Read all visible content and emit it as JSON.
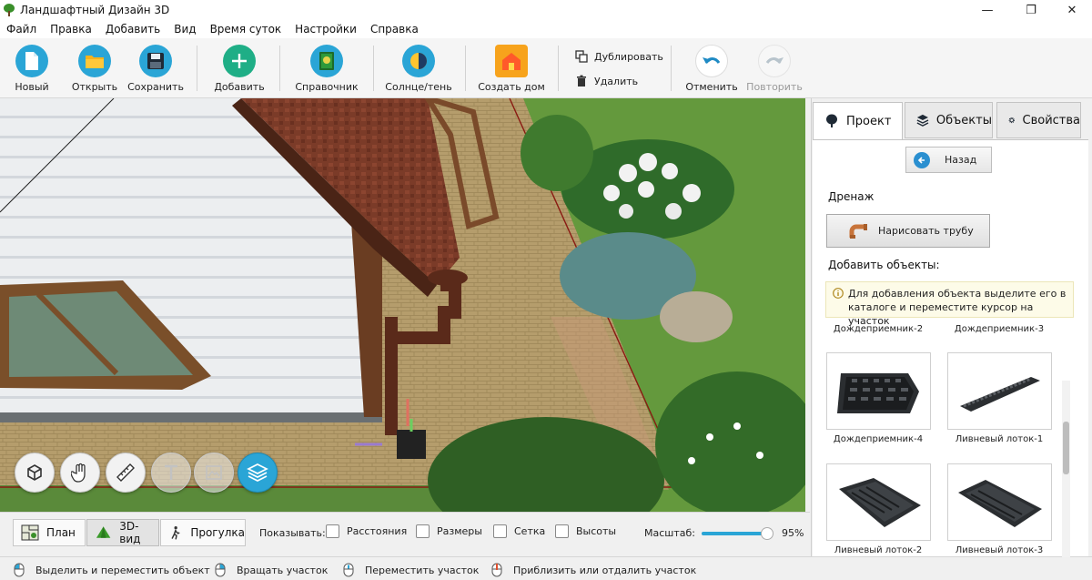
{
  "window": {
    "title": "Ландшафтный Дизайн 3D",
    "controls": {
      "minimize": "—",
      "maximize": "❐",
      "close": "✕"
    }
  },
  "menu": [
    "Файл",
    "Правка",
    "Добавить",
    "Вид",
    "Время суток",
    "Настройки",
    "Справка"
  ],
  "toolbar": {
    "new": "Новый",
    "open": "Открыть",
    "save": "Сохранить",
    "add": "Добавить",
    "reference": "Справочник",
    "sun_shadow": "Солнце/тень",
    "create_house": "Создать дом",
    "duplicate": "Дублировать",
    "delete": "Удалить",
    "undo": "Отменить",
    "redo": "Повторить"
  },
  "viewport_tools": [
    "rotate-view-icon",
    "pan-hand-icon",
    "ruler-icon",
    "text-icon",
    "image-icon",
    "layers-icon"
  ],
  "view_modes": {
    "plan": "План",
    "view3d": "3D-вид",
    "walk": "Прогулка",
    "active": "3D-вид"
  },
  "show": {
    "label": "Показывать:",
    "options": [
      {
        "label": "Расстояния",
        "checked": false
      },
      {
        "label": "Размеры",
        "checked": false
      },
      {
        "label": "Сетка",
        "checked": false
      },
      {
        "label": "Высоты",
        "checked": false
      }
    ]
  },
  "zoom": {
    "label": "Масштаб:",
    "value": "95%",
    "fraction": 0.92
  },
  "status_hints": [
    "Выделить и переместить объект",
    "Вращать участок",
    "Переместить участок",
    "Приблизить или отдалить участок"
  ],
  "panel": {
    "tabs": [
      "Проект",
      "Объекты",
      "Свойства"
    ],
    "active_tab": "Проект",
    "back_button": "Назад",
    "section_title": "Дренаж",
    "draw_pipe_button": "Нарисовать трубу",
    "add_objects_title": "Добавить объекты:",
    "notice": "Для добавления объекта выделите его в каталоге и переместите курсор на участок",
    "catalog_top_labels": [
      "Дождеприемник-2",
      "Дождеприемник-3"
    ],
    "catalog": [
      {
        "label": "Дождеприемник-4"
      },
      {
        "label": "Ливневый лоток-1"
      },
      {
        "label": "Ливневый лоток-2"
      },
      {
        "label": "Ливневый лоток-3"
      }
    ]
  },
  "colors": {
    "accent": "#2aa5d6",
    "grass": "#5a8a3a",
    "paving": "#b39a68",
    "roof": "#7a3a25",
    "siding": "#eceef0"
  }
}
